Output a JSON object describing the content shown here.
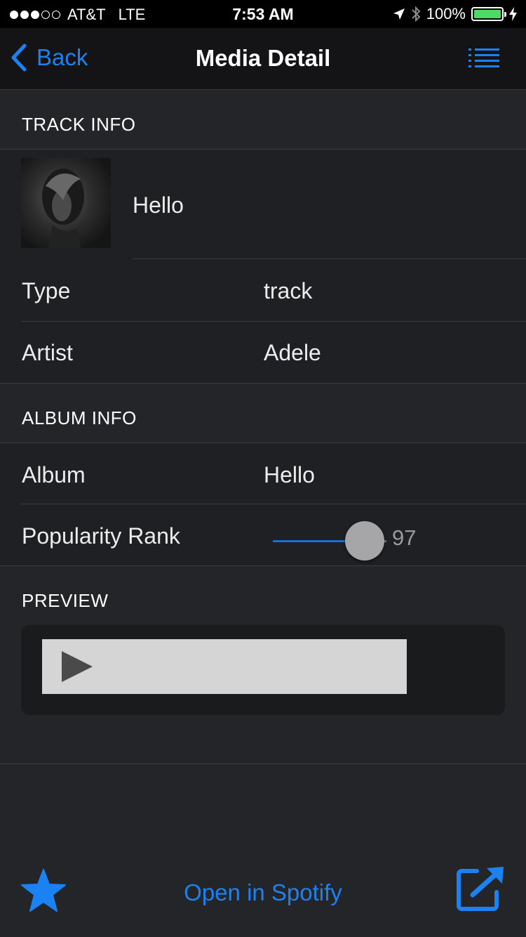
{
  "status_bar": {
    "signal_dots_filled": 3,
    "signal_dots_total": 5,
    "carrier": "AT&T",
    "network": "LTE",
    "time": "7:53 AM",
    "battery_percent": "100%",
    "battery_level": 1.0
  },
  "nav": {
    "back_label": "Back",
    "title": "Media Detail"
  },
  "track_info": {
    "header": "TRACK INFO",
    "track_name": "Hello",
    "rows": [
      {
        "label": "Type",
        "value": "track"
      },
      {
        "label": "Artist",
        "value": "Adele"
      }
    ]
  },
  "album_info": {
    "header": "ALBUM INFO",
    "album_label": "Album",
    "album_value": "Hello",
    "popularity_label": "Popularity Rank",
    "popularity_value": "97",
    "popularity_level": 0.97
  },
  "preview": {
    "header": "PREVIEW"
  },
  "toolbar": {
    "open_label": "Open in Spotify"
  },
  "colors": {
    "accent": "#1a82f2",
    "background": "#242528",
    "cell_background": "#1f2023",
    "battery": "#4cd964"
  }
}
